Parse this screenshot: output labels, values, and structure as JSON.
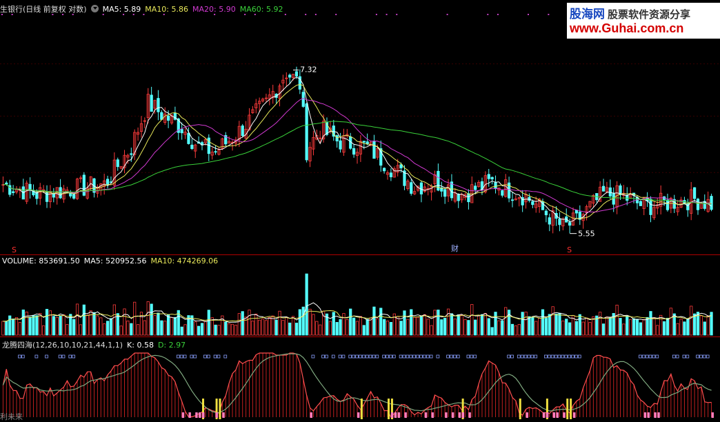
{
  "header": {
    "title": "生银行(日线 前复权 对数)",
    "ma5": "MA5: 5.89",
    "ma10": "MA10: 5.86",
    "ma20": "MA20: 5.90",
    "ma60": "MA60: 5.92"
  },
  "volume_header": {
    "label": "VOLUME: 853691.50",
    "ma5": "MA5: 520952.56",
    "ma10": "MA10: 474269.06"
  },
  "indicator_header": {
    "label": "龙腾四海(12,26,10,10,21,44,1,1)",
    "k": "K: 0.58",
    "d": "D: 2.97"
  },
  "watermark": {
    "line1_a": "股海网",
    "line1_b": "股票软件资源分享",
    "line2": "www.Guhai.com.cn"
  },
  "markers": {
    "high_label": "7.32",
    "low_label": "5.55",
    "cai_label": "财",
    "s_label": "S",
    "bottom_left": "利未来"
  },
  "colors": {
    "up": "#ff3b3b",
    "down": "#54ffff",
    "ma5": "#ffffff",
    "ma10": "#e8e85a",
    "ma20": "#d23ad2",
    "ma60": "#3ad23a",
    "background": "#000000"
  },
  "chart_data": [
    {
      "type": "candlestick",
      "title": "生银行(日线 前复权 对数)",
      "y_scale": "log",
      "ylim": [
        5.4,
        7.5
      ],
      "annotations": [
        {
          "text": "7.32",
          "kind": "high"
        },
        {
          "text": "5.55",
          "kind": "low"
        }
      ],
      "anchors": [
        [
          0,
          5.9
        ],
        [
          10,
          5.82
        ],
        [
          20,
          5.86
        ],
        [
          30,
          5.9
        ],
        [
          38,
          6.22
        ],
        [
          43,
          6.62
        ],
        [
          47,
          6.52
        ],
        [
          53,
          6.4
        ],
        [
          58,
          6.22
        ],
        [
          63,
          6.18
        ],
        [
          70,
          6.36
        ],
        [
          78,
          6.62
        ],
        [
          84,
          6.92
        ],
        [
          88,
          6.8
        ],
        [
          90,
          6.2
        ],
        [
          94,
          6.38
        ],
        [
          99,
          6.28
        ],
        [
          108,
          6.22
        ],
        [
          115,
          6.05
        ],
        [
          122,
          5.88
        ],
        [
          128,
          5.93
        ],
        [
          136,
          5.82
        ],
        [
          145,
          5.92
        ],
        [
          155,
          5.8
        ],
        [
          166,
          5.55
        ],
        [
          170,
          5.6
        ],
        [
          178,
          5.82
        ],
        [
          184,
          5.8
        ],
        [
          190,
          5.72
        ],
        [
          199,
          5.76
        ],
        [
          205,
          5.78
        ],
        [
          210,
          5.74
        ]
      ],
      "series": [
        {
          "name": "MA5",
          "value": 5.89
        },
        {
          "name": "MA10",
          "value": 5.86
        },
        {
          "name": "MA20",
          "value": 5.9
        },
        {
          "name": "MA60",
          "value": 5.92
        }
      ]
    },
    {
      "type": "bar",
      "title": "VOLUME",
      "latest": 853691.5,
      "ylim": [
        0,
        1900000
      ],
      "series": [
        {
          "name": "MA5",
          "value": 520952.56
        },
        {
          "name": "MA10",
          "value": 474269.06
        }
      ]
    },
    {
      "type": "line",
      "title": "龙腾四海(12,26,10,10,21,44,1,1)",
      "series": [
        {
          "name": "K",
          "value": 0.58
        },
        {
          "name": "D",
          "value": 2.97
        }
      ]
    }
  ]
}
